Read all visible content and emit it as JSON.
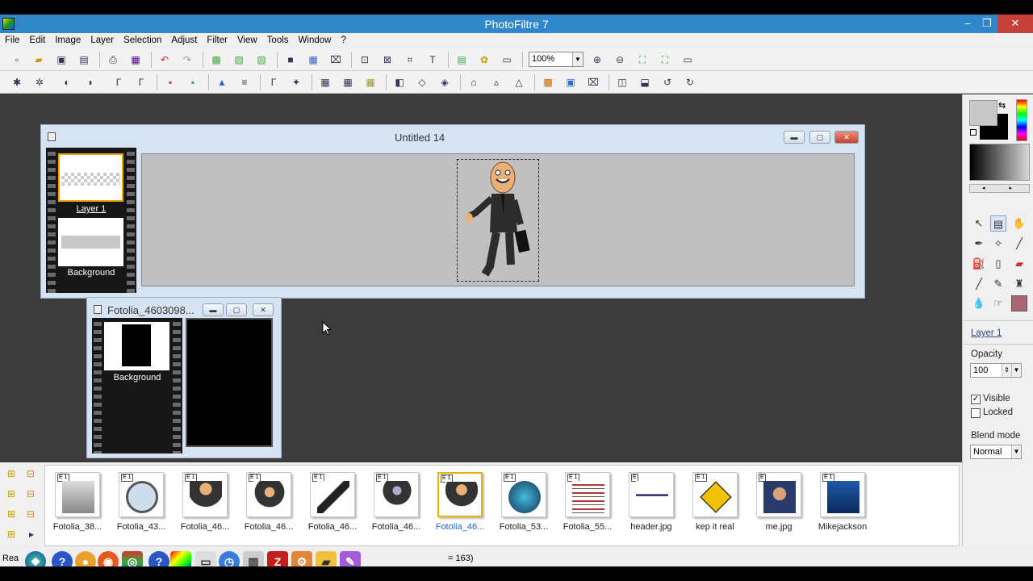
{
  "window": {
    "title": "PhotoFiltre 7",
    "minimize": "–",
    "maximize": "❐",
    "close": "✕"
  },
  "menu": [
    "File",
    "Edit",
    "Image",
    "Layer",
    "Selection",
    "Adjust",
    "Filter",
    "View",
    "Tools",
    "Window",
    "?"
  ],
  "toolbar": {
    "zoom": "100%"
  },
  "doc1": {
    "title": "Untitled 14",
    "layers": [
      {
        "label": "Layer 1"
      },
      {
        "label": "Background"
      }
    ]
  },
  "doc2": {
    "title": "Fotolia_4603098...",
    "layers": [
      {
        "label": "Background"
      }
    ]
  },
  "panel": {
    "layer_name": "Layer 1",
    "opacity_label": "Opacity",
    "opacity_value": "100",
    "visible_label": "Visible",
    "visible_checked": true,
    "locked_label": "Locked",
    "locked_checked": false,
    "blend_label": "Blend mode",
    "blend_value": "Normal",
    "colors": {
      "foreground": "#c8c8c8",
      "background": "#000000"
    }
  },
  "files": [
    {
      "caption": "Fotolia_38...",
      "tag": "E 1",
      "icon": "whiteboard-figure-icon"
    },
    {
      "caption": "Fotolia_43...",
      "tag": "E 1",
      "icon": "magnifier-figure-icon"
    },
    {
      "caption": "Fotolia_46...",
      "tag": "E 1",
      "icon": "businessman-icon"
    },
    {
      "caption": "Fotolia_46...",
      "tag": "E 1",
      "icon": "come-on-in-icon"
    },
    {
      "caption": "Fotolia_46...",
      "tag": "E 1",
      "icon": "treadmill-icon"
    },
    {
      "caption": "Fotolia_46...",
      "tag": "E 1",
      "icon": "question-figure-icon"
    },
    {
      "caption": "Fotolia_46...",
      "tag": "E 1",
      "icon": "businessman-briefcase-icon",
      "selected": true
    },
    {
      "caption": "Fotolia_53...",
      "tag": "E 1",
      "icon": "step-globe-icon"
    },
    {
      "caption": "Fotolia_55...",
      "tag": "E 1",
      "icon": "lottery-words-icon"
    },
    {
      "caption": "header.jpg",
      "tag": "E",
      "icon": "header-image-icon"
    },
    {
      "caption": "kep it real",
      "tag": "E 1",
      "icon": "keep-it-real-sign-icon"
    },
    {
      "caption": "me.jpg",
      "tag": "E",
      "icon": "portrait-photo-icon"
    },
    {
      "caption": "Mikejackson",
      "tag": "E 1",
      "icon": "dancer-silhouette-icon"
    }
  ],
  "status": {
    "left": "Rea",
    "coords": "= 163)"
  }
}
